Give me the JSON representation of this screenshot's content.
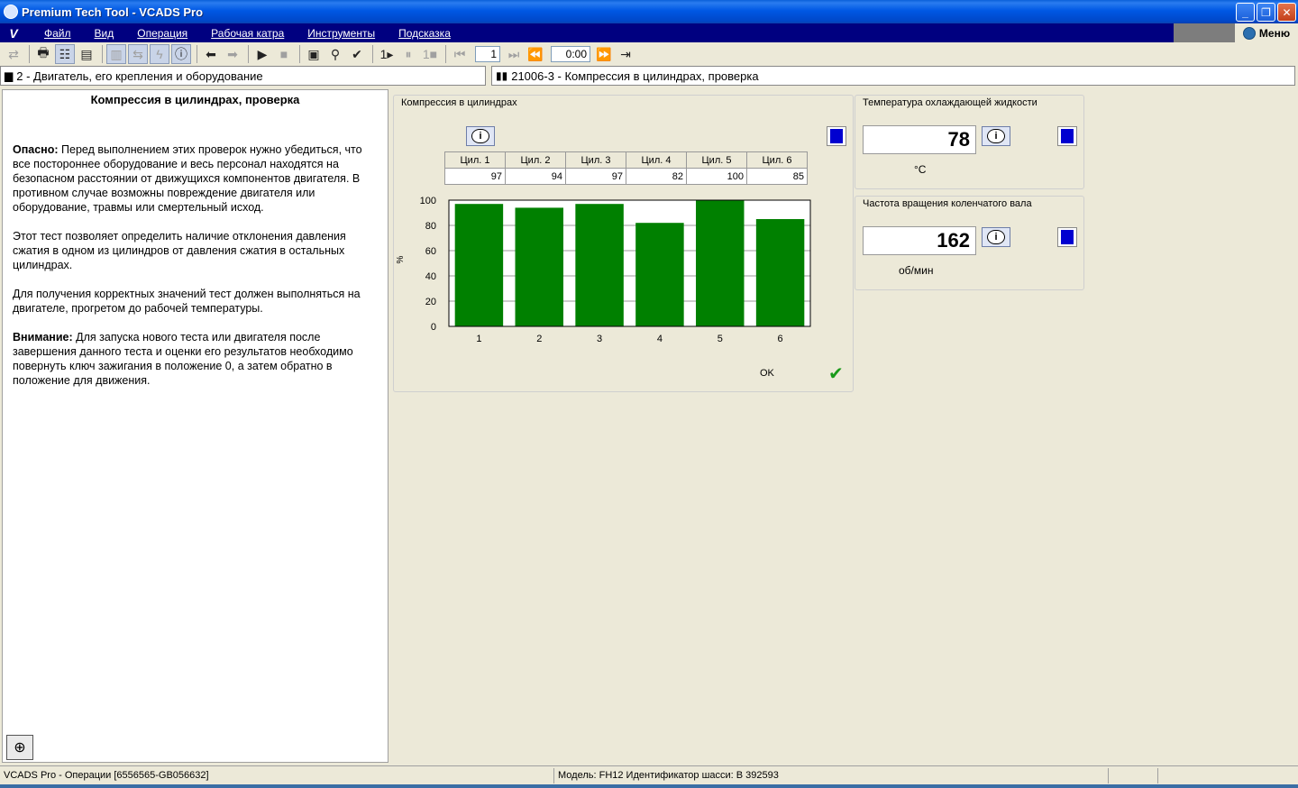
{
  "window": {
    "title": "Premium Tech Tool - VCADS Pro"
  },
  "menu": {
    "logo": "V",
    "items": [
      "Файл",
      "Вид",
      "Операция",
      "Рабочая катра",
      "Инструменты",
      "Подсказка"
    ],
    "menu_button": "Меню"
  },
  "toolbar": {
    "page_value": "1",
    "time_value": "0:00"
  },
  "breadcrumbs": {
    "left": "2 - Двигатель, его крепления и оборудование",
    "right": "21006-3 - Компрессия в цилиндрах, проверка"
  },
  "instructions": {
    "heading": "Компрессия в цилиндрах, проверка",
    "p1_bold": "Опасно:",
    "p1_text": " Перед выполнением этих проверок нужно убедиться, что все постороннее оборудование и весь персонал находятся на безопасном расстоянии от движущихся компонентов двигателя. В противном случае возможны повреждение двигателя или оборудование, травмы или смертельный исход.",
    "p2_text": "Этот тест позволяет определить наличие отклонения давления сжатия в одном из цилиндров от давления сжатия в остальных цилиндрах.",
    "p3_text": "Для получения корректных значений тест должен выполняться на двигателе, прогретом до рабочей температуры.",
    "p4_bold": "Внимание:",
    "p4_text": " Для запуска нового теста или двигателя после завершения данного теста и оценки его результатов необходимо повернуть ключ зажигания в положение 0, а затем обратно в положение для движения."
  },
  "compression_panel": {
    "title": "Компрессия в цилиндрах",
    "table_headers": [
      "Цил. 1",
      "Цил. 2",
      "Цил. 3",
      "Цил. 4",
      "Цил. 5",
      "Цил. 6"
    ],
    "table_values": [
      "97",
      "94",
      "97",
      "82",
      "100",
      "85"
    ],
    "status_text": "OK",
    "bar_color": "#008000"
  },
  "chart_data": {
    "type": "bar",
    "categories": [
      "1",
      "2",
      "3",
      "4",
      "5",
      "6"
    ],
    "values": [
      97,
      94,
      97,
      82,
      100,
      85
    ],
    "ylabel": "%",
    "ylim": [
      0,
      100
    ],
    "yticks": [
      "0",
      "20",
      "40",
      "60",
      "80",
      "100"
    ],
    "grid": true
  },
  "coolant_panel": {
    "title": "Температура охлаждающей жидкости",
    "value": "78",
    "unit": "°C"
  },
  "rpm_panel": {
    "title": "Частота вращения коленчатого вала",
    "value": "162",
    "unit": "об/мин"
  },
  "statusbar": {
    "left": "VCADS Pro - Операции   [6556565-GB056632]",
    "right": "Модель: FH12    Идентификатор шасси: B    392593"
  }
}
